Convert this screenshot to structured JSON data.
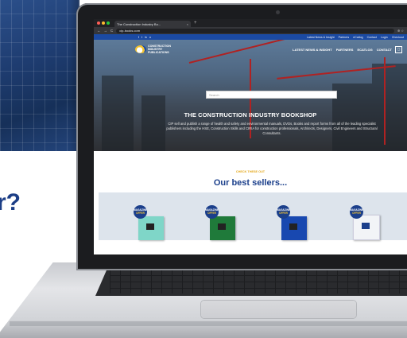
{
  "background": {
    "question_fragment": "r?",
    "accent_color": "#1c3e86"
  },
  "browser": {
    "tab_title": "The Construction Industry Bo...",
    "tab_close": "×",
    "new_tab": "+",
    "url": "cip-books.com",
    "nav_back": "←",
    "nav_forward": "→",
    "nav_reload": "C",
    "url_end": "⊕ ☆"
  },
  "site": {
    "social_icons": [
      "f",
      "t",
      "in",
      "o"
    ],
    "top_links": [
      "Latest News & Insight",
      "Partners",
      "eCatlog",
      "Contact",
      "Login",
      "Checkout"
    ],
    "logo_text": "CONSTRUCTION INDUSTRY PUBLICATIONS",
    "menu": [
      "LATEST NEWS & INSIGHT",
      "PARTNERS",
      "ECATLOG",
      "CONTACT"
    ],
    "cart_icon": "cart-icon",
    "search_placeholder": "Search",
    "hero_title": "THE CONSTRUCTION INDUSTRY BOOKSHOP",
    "hero_sub": "CIP sell and publish a range of health and safety and environmental manuals, DVDs, Books and report forms from all of the leading specialist publishers including the HSE, Construction Skills and CIRIA for construction professionals, Architects, Designers, Civil Engineers and Structural Consultants.",
    "kicker": "CHECK THESE OUT",
    "best_title": "Our best sellers...",
    "products": [
      {
        "badge_line1": "MAGAZINE",
        "badge_line2": "OFFER",
        "color": "#7fd6c8"
      },
      {
        "badge_line1": "MAGAZINE",
        "badge_line2": "OFFER",
        "color": "#1f7a3a"
      },
      {
        "badge_line1": "MAGAZINE",
        "badge_line2": "OFFER",
        "color": "#1848b0"
      },
      {
        "badge_line1": "MAGAZINE",
        "badge_line2": "OFFER",
        "color": "#f2f4f7"
      }
    ]
  },
  "colors": {
    "brand_blue": "#1b4aa3",
    "heading_blue": "#1b3f8b",
    "accent_yellow": "#e4a81c"
  }
}
